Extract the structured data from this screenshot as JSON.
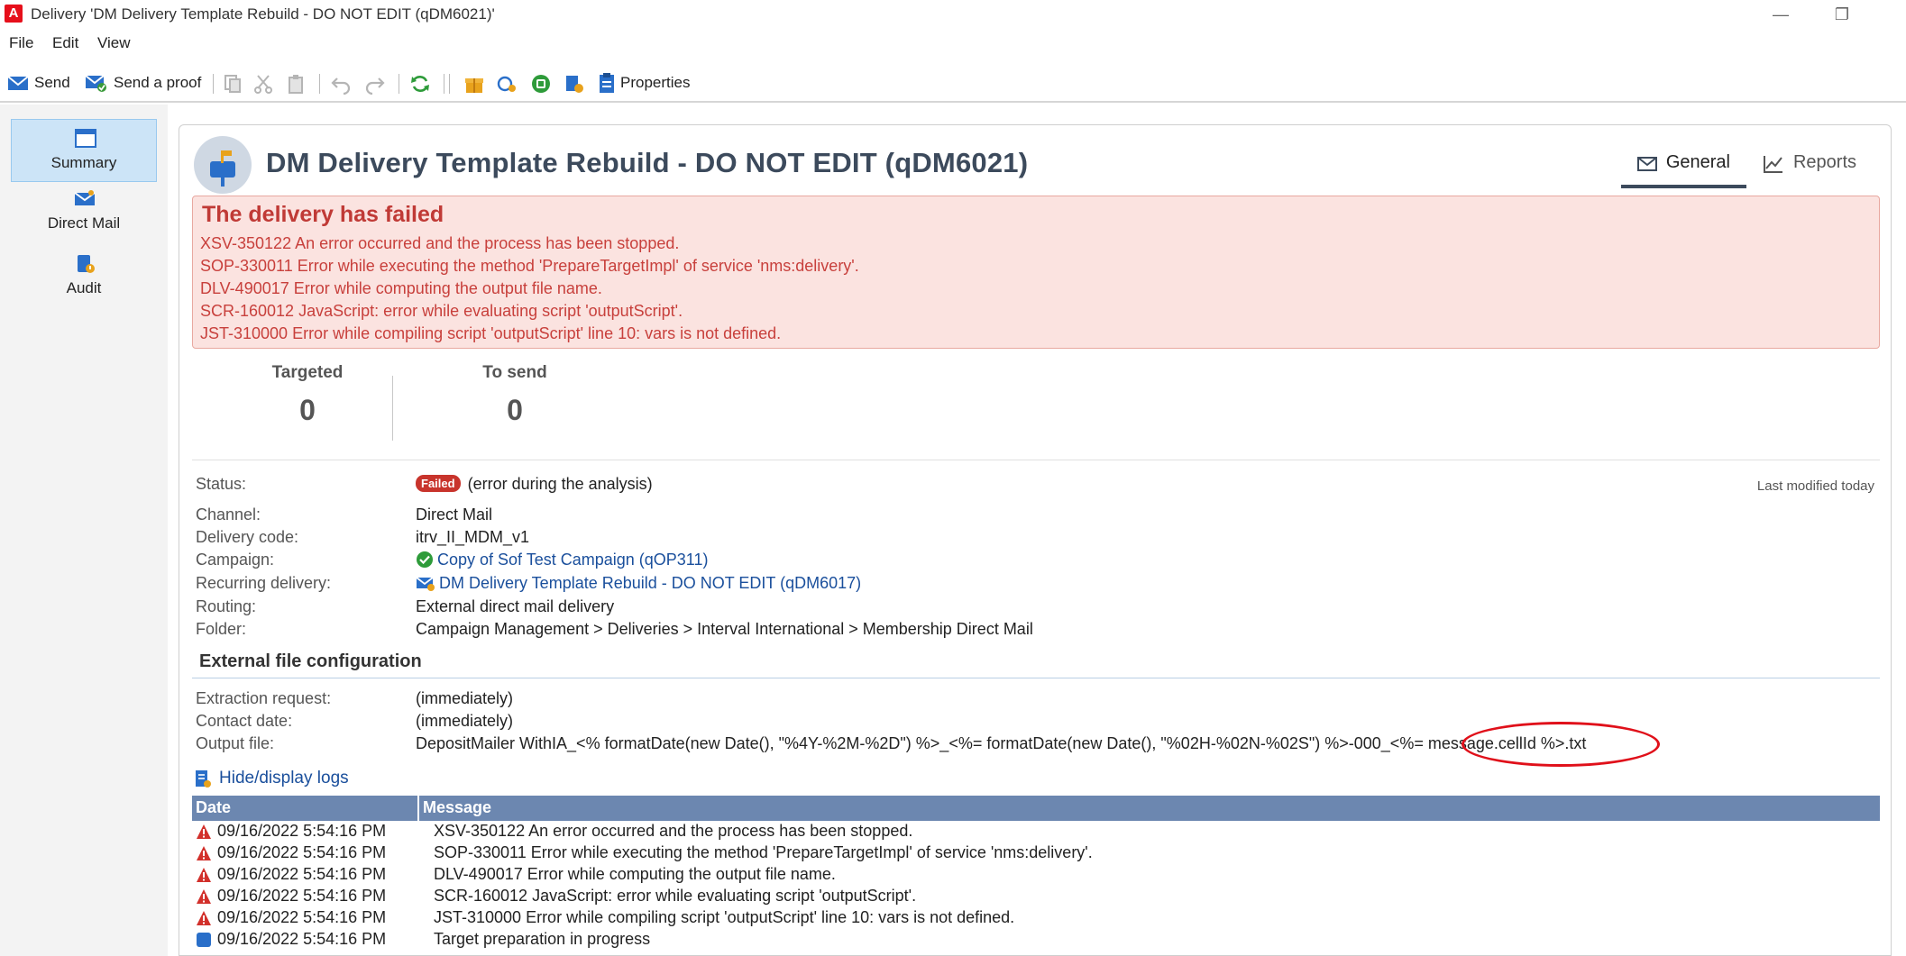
{
  "window": {
    "title": "Delivery 'DM Delivery Template Rebuild - DO NOT EDIT (qDM6021)'",
    "logo_letter": "A"
  },
  "menu": {
    "items": [
      "File",
      "Edit",
      "View"
    ]
  },
  "toolbar": {
    "send_label": "Send",
    "send_proof_label": "Send a proof",
    "properties_label": "Properties"
  },
  "sidebar": {
    "items": [
      {
        "label": "Summary",
        "icon": "summary-icon",
        "active": true
      },
      {
        "label": "Direct Mail",
        "icon": "direct-mail-icon",
        "active": false
      },
      {
        "label": "Audit",
        "icon": "audit-icon",
        "active": false
      }
    ]
  },
  "header": {
    "title": "DM Delivery Template Rebuild - DO NOT EDIT (qDM6021)",
    "tabs": [
      {
        "label": "General",
        "icon": "envelope-icon",
        "active": true
      },
      {
        "label": "Reports",
        "icon": "chart-line-icon",
        "active": false
      }
    ]
  },
  "error": {
    "title": "The delivery has failed",
    "lines": [
      "XSV-350122 An error occurred and the process has been stopped.",
      "SOP-330011 Error while executing the method 'PrepareTargetImpl' of service 'nms:delivery'.",
      "DLV-490017 Error while computing the output file name.",
      "SCR-160012 JavaScript: error while evaluating script 'outputScript'.",
      "JST-310000 Error while compiling script 'outputScript' line 10: vars is not defined."
    ]
  },
  "counters": {
    "targeted_label": "Targeted",
    "targeted_value": "0",
    "tosend_label": "To send",
    "tosend_value": "0"
  },
  "properties": {
    "status_label": "Status:",
    "status_badge": "Failed",
    "status_text": "(error during the analysis)",
    "last_modified": "Last modified today",
    "channel_label": "Channel:",
    "channel_value": "Direct Mail",
    "code_label": "Delivery code:",
    "code_value": "itrv_II_MDM_v1",
    "campaign_label": "Campaign:",
    "campaign_value": "Copy of Sof Test Campaign (qOP311)",
    "recurring_label": "Recurring delivery:",
    "recurring_value": "DM Delivery Template Rebuild - DO NOT EDIT (qDM6017)",
    "routing_label": "Routing:",
    "routing_value": "External direct mail delivery",
    "folder_label": "Folder:",
    "folder_value": "Campaign Management > Deliveries > Interval International > Membership Direct Mail"
  },
  "external": {
    "section_title": "External file configuration",
    "extraction_label": "Extraction request:",
    "extraction_value": "(immediately)",
    "contact_label": "Contact date:",
    "contact_value": "(immediately)",
    "output_label": "Output file:",
    "output_value": "DepositMailer WithIA_<% formatDate(new Date(), \"%4Y-%2M-%2D\") %>_<%= formatDate(new Date(), \"%02H-%02N-%02S\") %>-000_<%= message.cellId %>.txt"
  },
  "logs": {
    "toggle_label": "Hide/display logs",
    "col_date": "Date",
    "col_message": "Message",
    "rows": [
      {
        "type": "error",
        "date": "09/16/2022 5:54:16 PM",
        "message": "XSV-350122 An error occurred and the process has been stopped."
      },
      {
        "type": "error",
        "date": "09/16/2022 5:54:16 PM",
        "message": "SOP-330011 Error while executing the method 'PrepareTargetImpl' of service 'nms:delivery'."
      },
      {
        "type": "error",
        "date": "09/16/2022 5:54:16 PM",
        "message": "DLV-490017 Error while computing the output file name."
      },
      {
        "type": "error",
        "date": "09/16/2022 5:54:16 PM",
        "message": "SCR-160012 JavaScript: error while evaluating script 'outputScript'."
      },
      {
        "type": "error",
        "date": "09/16/2022 5:54:16 PM",
        "message": "JST-310000 Error while compiling script 'outputScript' line 10: vars is not defined."
      },
      {
        "type": "info",
        "date": "09/16/2022 5:54:16 PM",
        "message": "Target preparation in progress"
      }
    ]
  },
  "colors": {
    "error_red": "#c8403c",
    "link_blue": "#1a4f9c",
    "table_header": "#6c87b0"
  }
}
